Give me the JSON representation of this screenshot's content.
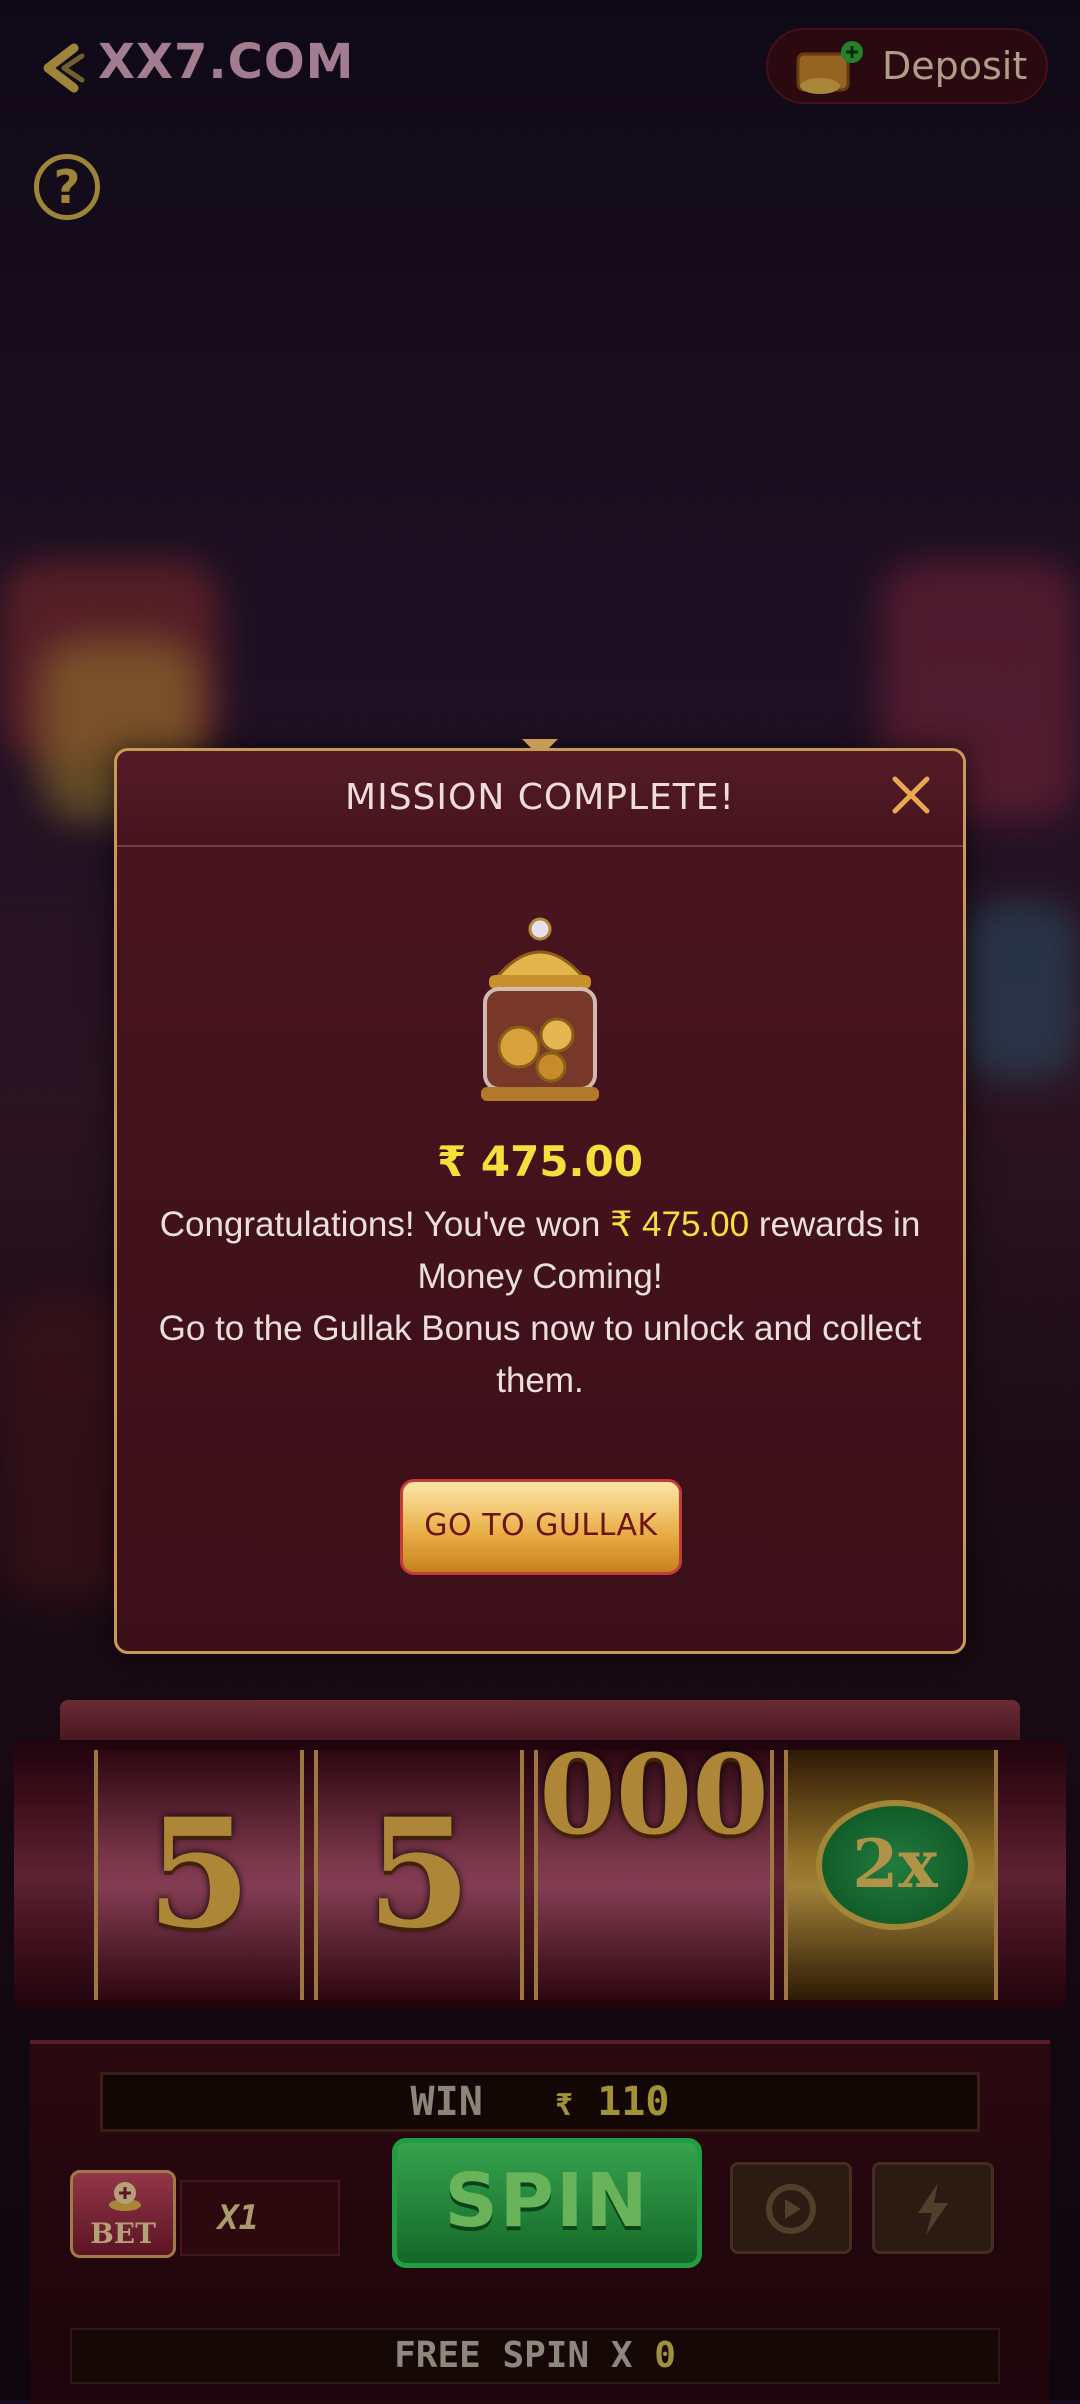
{
  "header": {
    "brand": "XX7.COM",
    "deposit_label": "Deposit"
  },
  "help_icon": "?",
  "reels": [
    "5",
    "5",
    "000"
  ],
  "multiplier": "2x",
  "console": {
    "win_label": "WIN",
    "currency": "₹",
    "win_value": "110",
    "bet_label": "BET",
    "bet_multiplier": "X1",
    "spin_label": "SPIN",
    "free_spin_label": "FREE SPIN X",
    "free_spin_count": "0"
  },
  "modal": {
    "title": "MISSION COMPLETE!",
    "amount": "₹ 475.00",
    "msg_prefix": "Congratulations! You've won ",
    "msg_amount": "₹ 475.00",
    "msg_suffix": " rewards in Money Coming!",
    "msg_line2": "Go to the Gullak Bonus now to unlock and collect them.",
    "button_label": "GO TO GULLAK"
  },
  "colors": {
    "accent_gold": "#c79a55",
    "amount_yellow": "#f3e03d",
    "modal_bg": "#3b0f19",
    "spin_green": "#2fd25a"
  }
}
